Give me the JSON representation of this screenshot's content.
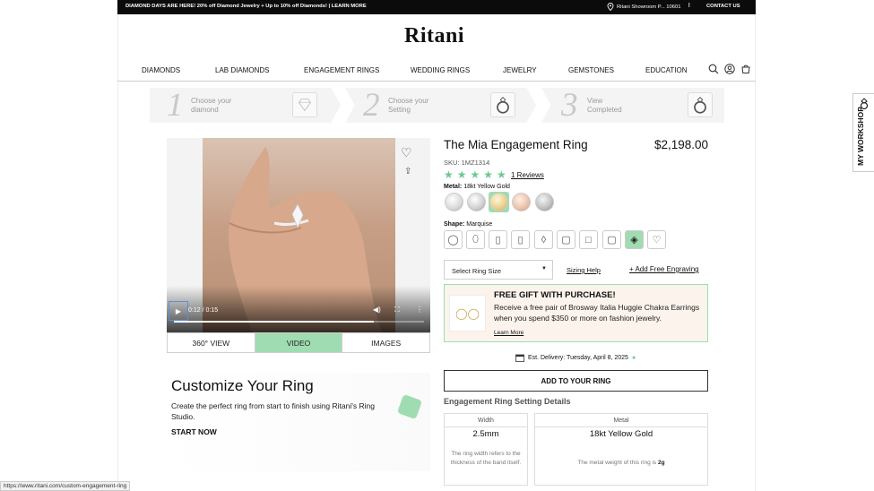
{
  "topbar": {
    "promo": "DIAMOND DAYS ARE HERE! 20% off Diamond Jewelry + Up to 10% off Diamonds! | LEARN MORE",
    "showroom": "Ritani Showroom P... 10601",
    "separator": "|",
    "contact": "CONTACT US"
  },
  "logo": "Ritani",
  "nav": {
    "items": [
      "DIAMONDS",
      "LAB DIAMONDS",
      "ENGAGEMENT RINGS",
      "WEDDING RINGS",
      "JEWELRY",
      "GEMSTONES",
      "EDUCATION"
    ]
  },
  "steps": [
    {
      "num": "1",
      "line1": "Choose your",
      "line2": "diamond"
    },
    {
      "num": "2",
      "line1": "Choose your",
      "line2": "Setting"
    },
    {
      "num": "3",
      "line1": "View",
      "line2": "Completed"
    }
  ],
  "video": {
    "time": "0:12 / 0:15",
    "progress_fraction": 0.8
  },
  "view_tabs": [
    "360° VIEW",
    "VIDEO",
    "IMAGES"
  ],
  "customize": {
    "title": "Customize Your Ring",
    "description": "Create the perfect ring from start to finish using Ritani's Ring Studio.",
    "cta": "START NOW"
  },
  "product": {
    "title": "The Mia Engagement Ring",
    "price": "$2,198.00",
    "sku": "SKU: 1MZ1314",
    "rating": 5,
    "stars": "★★★★★",
    "reviews": "1 Reviews",
    "metal_label": "Metal:",
    "metal_value": "18kt Yellow Gold",
    "metal_colors": [
      "#d9d9d9",
      "#cfcfcf",
      "#e8cf8a",
      "#e9c1a8",
      "#bdbdbd"
    ],
    "shape_label": "Shape:",
    "shape_value": "Marquise",
    "size_select": "Select Ring Size",
    "sizing_help": "Sizing Help",
    "engraving": "+ Add Free Engraving"
  },
  "gift": {
    "title": "FREE GIFT WITH PURCHASE!",
    "description": "Receive a free pair of Brosway Italia Huggie Chakra Earrings when you spend $350 or more on fashion jewelry.",
    "link": "Learn More"
  },
  "delivery": "Est. Delivery: Tuesday, April 8, 2025",
  "add_button": "ADD TO YOUR RING",
  "details": {
    "heading": "Engagement Ring Setting Details",
    "width": {
      "label": "Width",
      "value": "2.5mm",
      "note": "The ring width refers to the thickness of the band itself."
    },
    "metal": {
      "label": "Metal",
      "value": "18kt Yellow Gold",
      "note_prefix": "The metal weight of this ring is",
      "note_value": "2g"
    }
  },
  "workshop": "MY WORKSHOP",
  "status_url": "https://www.ritani.com/custom-engagement-ring",
  "colors": {
    "accent": "#9fdcb2",
    "star": "#6fc98f"
  }
}
